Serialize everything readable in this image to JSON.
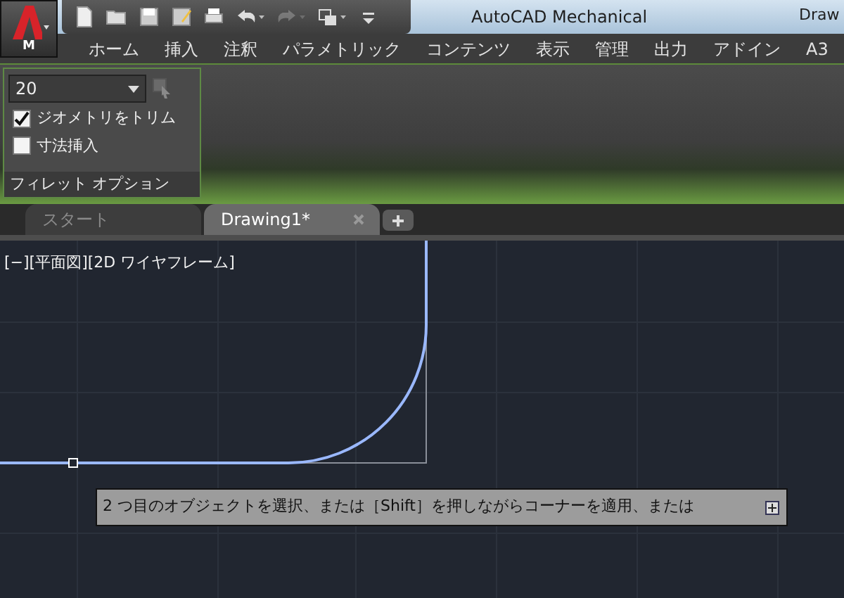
{
  "app_button": {
    "label": "M"
  },
  "quick_access": [
    {
      "kind": "new",
      "disabled": false
    },
    {
      "kind": "open",
      "disabled": false
    },
    {
      "kind": "save",
      "disabled": false
    },
    {
      "kind": "save-as",
      "disabled": false
    },
    {
      "kind": "print",
      "disabled": false
    },
    {
      "kind": "undo",
      "disabled": false
    },
    {
      "kind": "redo",
      "disabled": true
    },
    {
      "kind": "workspace",
      "disabled": false
    },
    {
      "kind": "more",
      "disabled": false
    }
  ],
  "title": {
    "app": "AutoCAD Mechanical",
    "document": "Draw"
  },
  "ribbon_tabs": [
    {
      "label": "ホーム"
    },
    {
      "label": "挿入"
    },
    {
      "label": "注釈"
    },
    {
      "label": "パラメトリック"
    },
    {
      "label": "コンテンツ"
    },
    {
      "label": "表示"
    },
    {
      "label": "管理"
    },
    {
      "label": "出力"
    },
    {
      "label": "アドイン"
    },
    {
      "label": "A3"
    }
  ],
  "panel": {
    "dropdown": {
      "value": "20"
    },
    "options": [
      {
        "label": "ジオメトリをトリム",
        "checked": true
      },
      {
        "label": "寸法挿入",
        "checked": false
      }
    ],
    "title": "フィレット オプション"
  },
  "file_tabs": [
    {
      "label": "スタート",
      "selected": false
    },
    {
      "label": "Drawing1*",
      "selected": true
    }
  ],
  "viewport_label": "[−][平面図][2D ワイヤフレーム]",
  "command_prompt": {
    "text": "2 つ目のオブジェクトを選択、または［Shift］を押しながらコーナーを適用、または"
  }
}
